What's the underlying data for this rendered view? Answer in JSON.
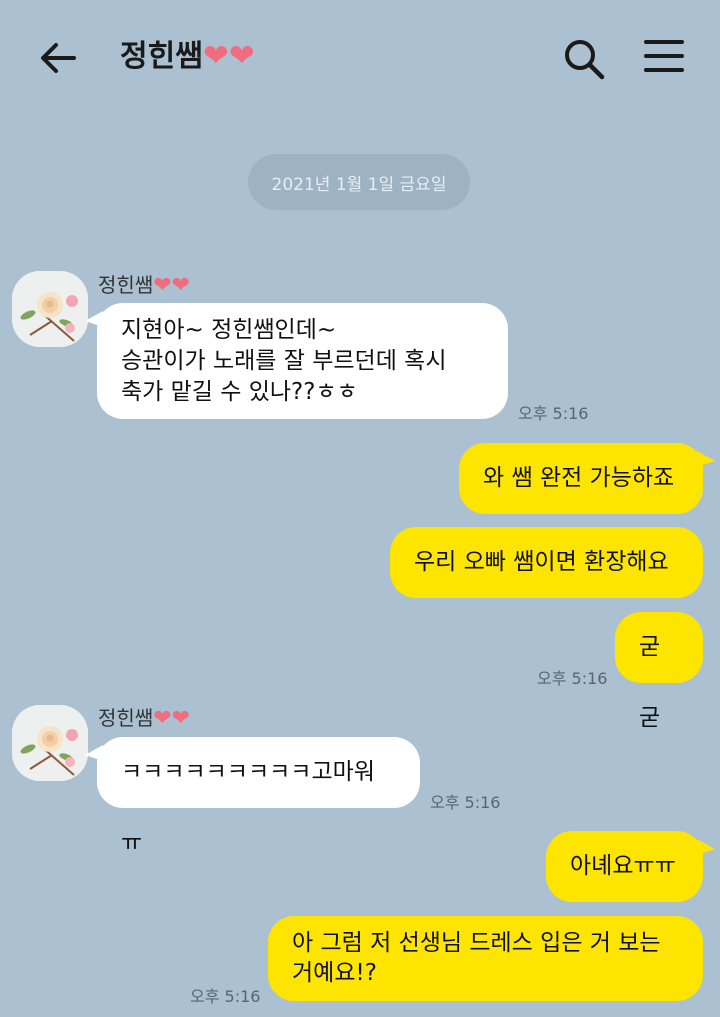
{
  "header": {
    "title": "정힌쌤",
    "hearts": "❤❤"
  },
  "date_divider": "2021년 1월 1일 금요일",
  "messages": [
    {
      "sender": "정힌쌤",
      "hearts": "❤❤",
      "lines": [
        "지현아~ 정힌쌤인데~",
        "승관이가 노래를 잘 부르던데 혹시",
        "축가 맡길 수 있나??ㅎㅎ"
      ],
      "time": "오후 5:16"
    },
    {
      "text": "와 쌤 완전 가능하죠"
    },
    {
      "text": "우리 오빠 쌤이면 환장해요"
    },
    {
      "text": "굳굳",
      "time": "오후 5:16"
    },
    {
      "sender": "정힌쌤",
      "hearts": "❤❤",
      "text": "ㅋㅋㅋㅋㅋㅋㅋㅋㅋ고마워 ㅠ",
      "time": "오후 5:16"
    },
    {
      "text": "아녜요ㅠㅠ"
    },
    {
      "lines": [
        "아 그럼 저 선생님 드레스 입은 거 보는",
        "거예요!?"
      ],
      "time": "오후 5:16"
    }
  ]
}
